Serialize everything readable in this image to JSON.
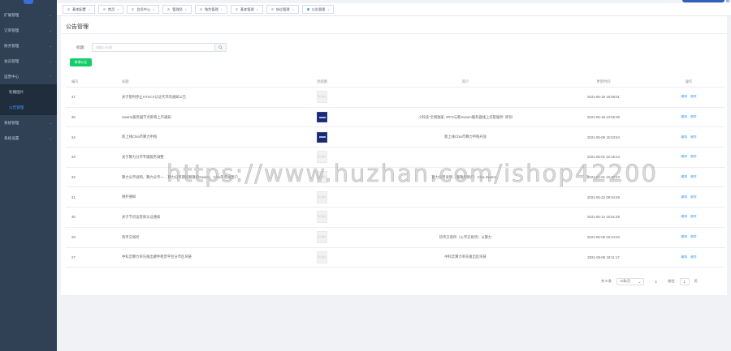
{
  "sidebar": {
    "items": [
      {
        "label": "扩展管理"
      },
      {
        "label": "订单管理"
      },
      {
        "label": "财务管理"
      },
      {
        "label": "会员管理"
      },
      {
        "label": "运营中心"
      }
    ],
    "submenu": [
      {
        "label": "轮播图片"
      },
      {
        "label": "公告管理"
      }
    ],
    "bottom_items": [
      {
        "label": "系统管理"
      },
      {
        "label": "系统设置"
      }
    ]
  },
  "tabs": [
    {
      "label": "基本配置"
    },
    {
      "label": "首页"
    },
    {
      "label": "会员中心"
    },
    {
      "label": "管理员"
    },
    {
      "label": "角色管理"
    },
    {
      "label": "基本管理"
    },
    {
      "label": "协议管理"
    },
    {
      "label": "公告管理"
    }
  ],
  "page": {
    "title": "公告管理",
    "search_label": "标题:",
    "search_placeholder": "请输入标题",
    "add_button": "新增公告"
  },
  "table": {
    "headers": {
      "id": "编号",
      "title": "标题",
      "image": "封面图",
      "intro": "简介",
      "time": "更新时间",
      "op": "操作"
    },
    "placeholder_img_text": "暂无图片",
    "edit_label": "编辑",
    "delete_label": "删除",
    "rows": [
      {
        "id": "37",
        "title": "关于暂时停止HTXCX认证代币的通知公告",
        "img": "blank",
        "intro": "",
        "time": "2021-05-18 16:59:01"
      },
      {
        "id": "36",
        "title": "Swarm服务器节点即将上市通知",
        "img": "dark",
        "intro": "小科技\"全网独家, IPFS与新Swarm服务器线上托管服务\" 即刻",
        "time": "2021-05-18 10:55:38"
      },
      {
        "id": "34",
        "title": "新上线Chia币算力申购",
        "img": "dark",
        "intro": "新上线Chia币算力申购开放",
        "time": "2021-05-09 15:53:54"
      },
      {
        "id": "33",
        "title": "关于算力分币专属服务调整",
        "img": "blank",
        "intro": "",
        "time": "2021-05-01 22:15:24"
      },
      {
        "id": "32",
        "title": "算力分币说明，算力分币一... 算力分币期间尊敬的Swarm、Chia等各类用户",
        "img": "blank",
        "intro": "算力分币说明... 尊敬的用户：Chia Swarm...",
        "time": "2021-05-01 15:30:13"
      },
      {
        "id": "31",
        "title": "维护通知",
        "img": "blank",
        "intro": "",
        "time": "2021-05-22 09:54:48"
      },
      {
        "id": "30",
        "title": "关于节点运营商认证通知",
        "img": "blank",
        "intro": "",
        "time": "2021-05-14 15:51:29"
      },
      {
        "id": "28",
        "title": "热币交易所",
        "img": "blank",
        "intro": "热币交易所（火币交易所）以算力",
        "time": "2021-05-09 15:24:33"
      },
      {
        "id": "27",
        "title": "中科云算力率先推出硬件租赁平台分币区块链",
        "img": "blank",
        "intro": "中科云算力率先推出区块链",
        "time": "2021-05-05 19:11:17"
      }
    ]
  },
  "pager": {
    "total": "共 9 条",
    "size": "10条/页",
    "current": "1",
    "goto_label": "前往",
    "goto_value": "1",
    "page_unit": "页"
  },
  "watermark": "https://www.huzhan.com/ishop42200"
}
